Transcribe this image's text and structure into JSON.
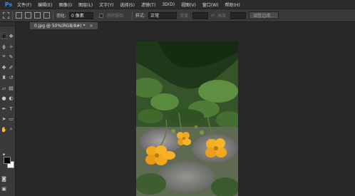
{
  "app": {
    "logo": "Ps"
  },
  "menu": [
    "文件(F)",
    "编辑(E)",
    "图像(I)",
    "图层(L)",
    "文字(Y)",
    "选择(S)",
    "滤镜(T)",
    "3D(D)",
    "视图(V)",
    "窗口(W)",
    "帮助(H)"
  ],
  "options": {
    "feather_label": "羽化:",
    "feather_value": "0 像素",
    "antialias_label": "消除锯齿",
    "style_label": "样式:",
    "style_value": "正常",
    "width_label": "宽度:",
    "height_label": "高度:",
    "refine_edge": "调整边缘..."
  },
  "document": {
    "tab_title": "0.jpg @ 50%(RGB/8#) *",
    "close": "×"
  },
  "tools": [
    "rectangular-marquee-icon",
    "move-icon",
    "lasso-icon",
    "magic-wand-icon",
    "crop-icon",
    "eyedropper-icon",
    "spot-healing-icon",
    "brush-icon",
    "clone-stamp-icon",
    "history-brush-icon",
    "eraser-icon",
    "gradient-icon",
    "blur-icon",
    "dodge-icon",
    "pen-icon",
    "type-icon",
    "path-selection-icon",
    "rectangle-shape-icon",
    "hand-icon",
    "zoom-icon"
  ],
  "colors": {
    "foreground": "#000000",
    "background": "#ffffff",
    "accent": "#2f8fe8"
  }
}
